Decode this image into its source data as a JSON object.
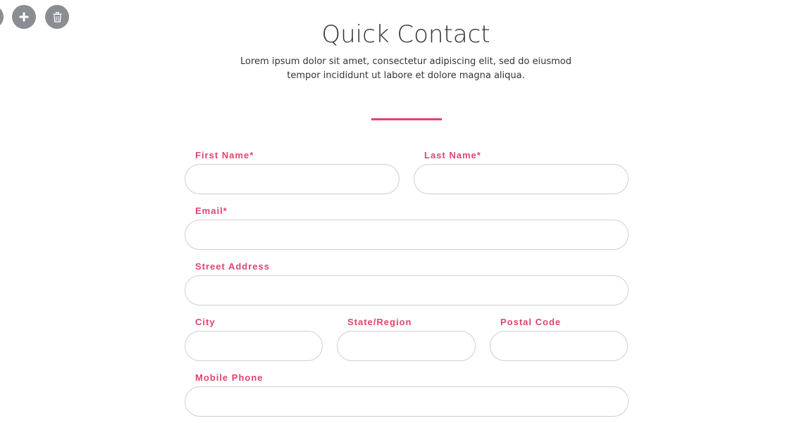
{
  "toolbar": {
    "items": [
      {
        "name": "partial-button",
        "icon": "circle-icon"
      },
      {
        "name": "add-button",
        "icon": "plus-icon"
      },
      {
        "name": "delete-button",
        "icon": "trash-icon"
      }
    ],
    "color": "#8a8d91"
  },
  "header": {
    "title": "Quick Contact",
    "subtitle": "Lorem ipsum dolor sit amet, consectetur adipiscing elit, sed do eiusmod tempor incididunt ut labore et dolore magna aliqua."
  },
  "accent_color": "#e0446c",
  "form": {
    "first_name": {
      "label": "First Name*",
      "value": ""
    },
    "last_name": {
      "label": "Last Name*",
      "value": ""
    },
    "email": {
      "label": "Email*",
      "value": ""
    },
    "street": {
      "label": "Street Address",
      "value": ""
    },
    "city": {
      "label": "City",
      "value": ""
    },
    "state": {
      "label": "State/Region",
      "value": ""
    },
    "postal": {
      "label": "Postal Code",
      "value": ""
    },
    "mobile": {
      "label": "Mobile Phone",
      "value": ""
    }
  }
}
